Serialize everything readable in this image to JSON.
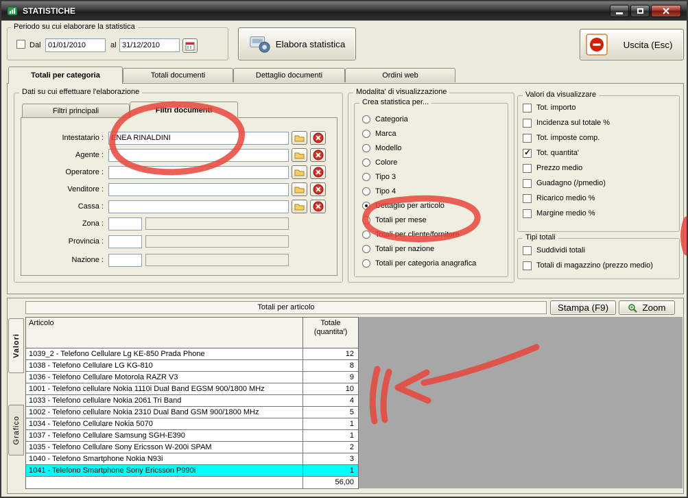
{
  "window": {
    "title": "STATISTICHE"
  },
  "period": {
    "group_label": "Periodo su cui elaborare la statistica",
    "dal_label": "Dal",
    "date_from": "01/01/2010",
    "al_label": "al",
    "date_to": "31/12/2010"
  },
  "actions": {
    "elabora_label": "Elabora statistica",
    "uscita_label": "Uscita (Esc)"
  },
  "tabs": [
    {
      "label": "Totali per categoria",
      "active": true
    },
    {
      "label": "Totali documenti",
      "active": false
    },
    {
      "label": "Dettaglio documenti",
      "active": false
    },
    {
      "label": "Ordini web",
      "active": false
    }
  ],
  "filters": {
    "group_label": "Dati su cui effettuare l'elaborazione",
    "subtabs": [
      {
        "label": "Filtri principali",
        "active": false
      },
      {
        "label": "Filtri documenti",
        "active": true
      }
    ],
    "fields": [
      {
        "label": "Intestatario :",
        "value": "ENEA RINALDINI"
      },
      {
        "label": "Agente :",
        "value": ""
      },
      {
        "label": "Operatore :",
        "value": ""
      },
      {
        "label": "Venditore :",
        "value": ""
      },
      {
        "label": "Cassa :",
        "value": ""
      }
    ],
    "zone_fields": [
      {
        "label": "Zona :",
        "code": "",
        "value": ""
      },
      {
        "label": "Provincia :",
        "code": "",
        "value": ""
      },
      {
        "label": "Nazione :",
        "code": "",
        "value": ""
      }
    ]
  },
  "visualization": {
    "group_label": "Modalita' di visualizzazione",
    "radio_group_label": "Crea statistica per...",
    "options": [
      {
        "label": "Categoria",
        "selected": false
      },
      {
        "label": "Marca",
        "selected": false
      },
      {
        "label": "Modello",
        "selected": false
      },
      {
        "label": "Colore",
        "selected": false
      },
      {
        "label": "Tipo 3",
        "selected": false
      },
      {
        "label": "Tipo 4",
        "selected": false
      },
      {
        "label": "Dettaglio per articolo",
        "selected": true
      },
      {
        "label": "Totali per mese",
        "selected": false
      },
      {
        "label": "Totali per cliente/fornitore",
        "selected": false
      },
      {
        "label": "Totali per nazione",
        "selected": false
      },
      {
        "label": "Totali per categoria anagrafica",
        "selected": false
      }
    ]
  },
  "values_panel": {
    "group_label": "Valori da visualizzare",
    "checkboxes": [
      {
        "label": "Tot. importo",
        "checked": false
      },
      {
        "label": "Incidenza sul totale %",
        "checked": false
      },
      {
        "label": "Tot. imposte comp.",
        "checked": false
      },
      {
        "label": "Tot. quantita'",
        "checked": true
      },
      {
        "label": "Prezzo medio",
        "checked": false
      },
      {
        "label": "Guadagno (/pmedio)",
        "checked": false
      },
      {
        "label": "Ricarico medio %",
        "checked": false
      },
      {
        "label": "Margine medio %",
        "checked": false
      }
    ]
  },
  "totals_panel": {
    "group_label": "Tipi totali",
    "checkboxes": [
      {
        "label": "Suddividi totali",
        "checked": false
      },
      {
        "label": "Totali di magazzino (prezzo medio)",
        "checked": false
      }
    ]
  },
  "results": {
    "header": "Totali per articolo",
    "stampa_label": "Stampa (F9)",
    "zoom_label": "Zoom",
    "side_tabs": [
      {
        "label": "Valori",
        "active": true
      },
      {
        "label": "Grafico",
        "active": false
      }
    ],
    "columns": {
      "articolo": "Articolo",
      "totale_line1": "Totale",
      "totale_line2": "(quantita')"
    },
    "rows": [
      {
        "articolo": "1039_2 - Telefono Cellulare Lg KE-850 Prada Phone",
        "totale": "12"
      },
      {
        "articolo": "1038 - Telefono Cellulare LG KG-810",
        "totale": "8"
      },
      {
        "articolo": "1036 - Telefono Cellulare Motorola RAZR V3",
        "totale": "9"
      },
      {
        "articolo": "1001 - Telefono cellulare Nokia 1110i Dual Band EGSM 900/1800 MHz",
        "totale": "10"
      },
      {
        "articolo": "1033 - Telefono cellulare Nokia 2061 Tri Band",
        "totale": "4"
      },
      {
        "articolo": "1002 - Telefono cellulare Nokia 2310 Dual Band GSM 900/1800 MHz",
        "totale": "5"
      },
      {
        "articolo": "1034 - Telefono Cellulare Nokia 5070",
        "totale": "1"
      },
      {
        "articolo": "1037 - Telefono Cellulare Samsung SGH-E390",
        "totale": "1"
      },
      {
        "articolo": "1035 - Telefono Cellulare Sony Ericsson W-200i SPAM",
        "totale": "2"
      },
      {
        "articolo": "1040 - Telefono Smartphone Nokia N93i",
        "totale": "3"
      },
      {
        "articolo": "1041 - Telefono Smartphone Sony Ericsson P990i",
        "totale": "1"
      }
    ],
    "grand_total": "56,00"
  },
  "colors": {
    "selected_row": "#00ffff",
    "annotation": "#e8453a",
    "title_bar": "#2e2e2e",
    "panel_bg": "#f0eee1"
  }
}
